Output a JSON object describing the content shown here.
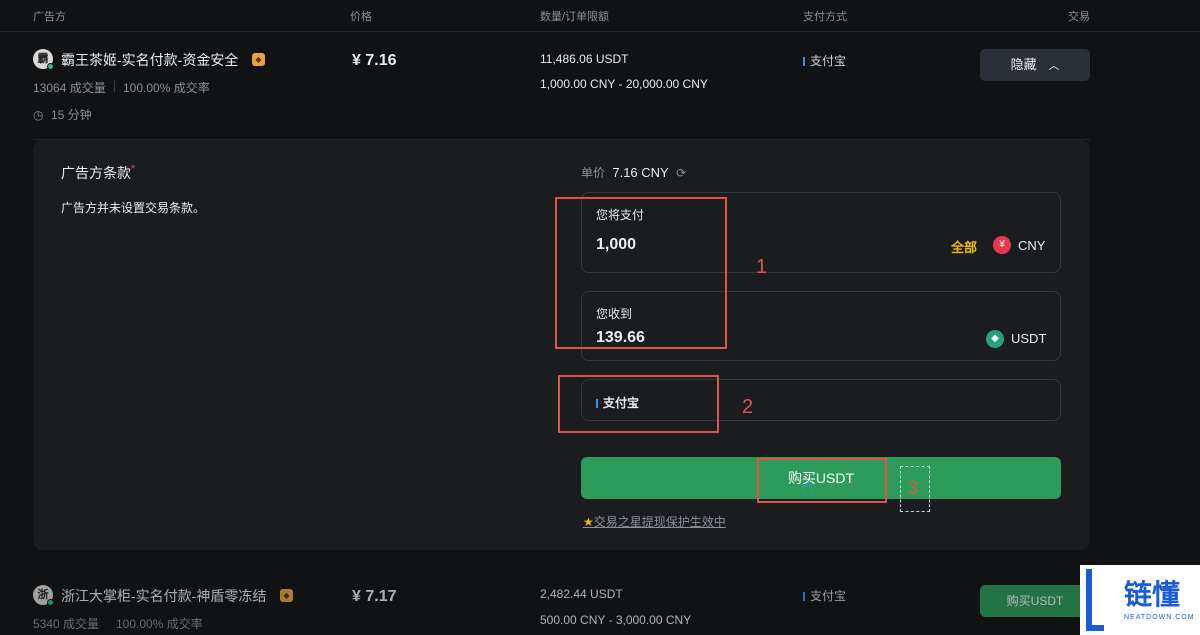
{
  "table_header": {
    "advertiser": "广告方",
    "price": "价格",
    "quantity": "数量/订单限额",
    "payment": "支付方式",
    "trade": "交易"
  },
  "listing1": {
    "avatar_char": "霸",
    "name": "霸王茶姬-实名付款-资金安全",
    "volume": "13064 成交量",
    "rate": "100.00% 成交率",
    "time": "15 分钟",
    "price": "¥ 7.16",
    "available": "11,486.06 USDT",
    "limits": "1,000.00 CNY - 20,000.00 CNY",
    "payment": "支付宝",
    "hide_label": "隐藏"
  },
  "panel": {
    "terms_title": "广告方条款",
    "terms_required": "*",
    "terms_text": "广告方并未设置交易条款。",
    "unit_price_label": "单价",
    "unit_price": "7.16 CNY",
    "pay_label": "您将支付",
    "pay_value": "1,000",
    "all_label": "全部",
    "pay_currency": "CNY",
    "receive_label": "您收到",
    "receive_value": "139.66",
    "receive_currency": "USDT",
    "payment_method": "支付宝",
    "buy_label": "购买USDT",
    "footer_note": "交易之星提现保护生效中"
  },
  "listing2": {
    "avatar_char": "浙",
    "name": "浙江大掌柜-实名付款-神盾零冻结",
    "volume": "5340 成交量",
    "rate": "100.00% 成交率",
    "price": "¥ 7.17",
    "available": "2,482.44 USDT",
    "limits": "500.00 CNY - 3,000.00 CNY",
    "payment": "支付宝",
    "buy_label": "购买USDT"
  },
  "annotations": {
    "one": "1",
    "two": "2",
    "three": "3"
  },
  "watermark": {
    "text": "链懂",
    "sub": "NEATDOWN.COM"
  },
  "colors": {
    "accent_green": "#2d9c5a",
    "highlight_red": "#e2524a",
    "all_gold": "#f0b90b"
  }
}
